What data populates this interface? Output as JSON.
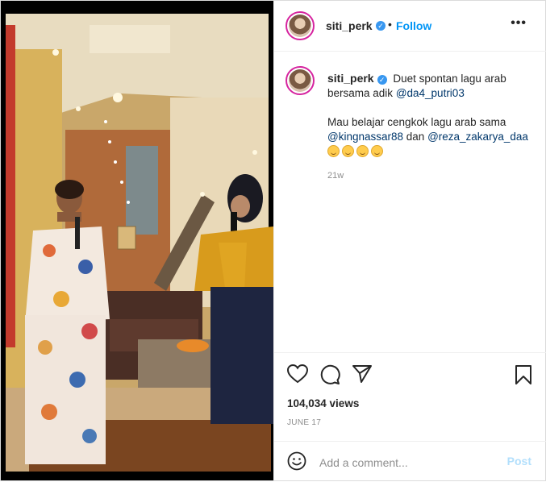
{
  "post": {
    "username": "siti_perk",
    "follow_label": "Follow",
    "separator": "•",
    "more_label": "•••"
  },
  "caption": {
    "username": "siti_perk",
    "line1": "Duet spontan lagu arab bersama adik",
    "mention1": "@da4_putri03",
    "line2": "Mau belajar cengkok lagu arab sama",
    "mention2": "@kingnassar88",
    "and_word": "dan",
    "mention3": "@reza_zakarya_daa",
    "emoji": "smiling-face-emoji",
    "emoji_count": 4,
    "age": "21w"
  },
  "stats": {
    "views": "104,034 views",
    "date": "JUNE 17"
  },
  "comment": {
    "placeholder": "Add a comment...",
    "post_label": "Post"
  },
  "icons": {
    "like": "heart-icon",
    "comment": "comment-icon",
    "share": "share-icon",
    "save": "bookmark-icon",
    "emoji": "emoji-icon"
  },
  "colors": {
    "accent": "#0095f6",
    "verified": "#3897f0",
    "post_disabled": "#b2dffc",
    "muted": "#8e8e8e"
  }
}
